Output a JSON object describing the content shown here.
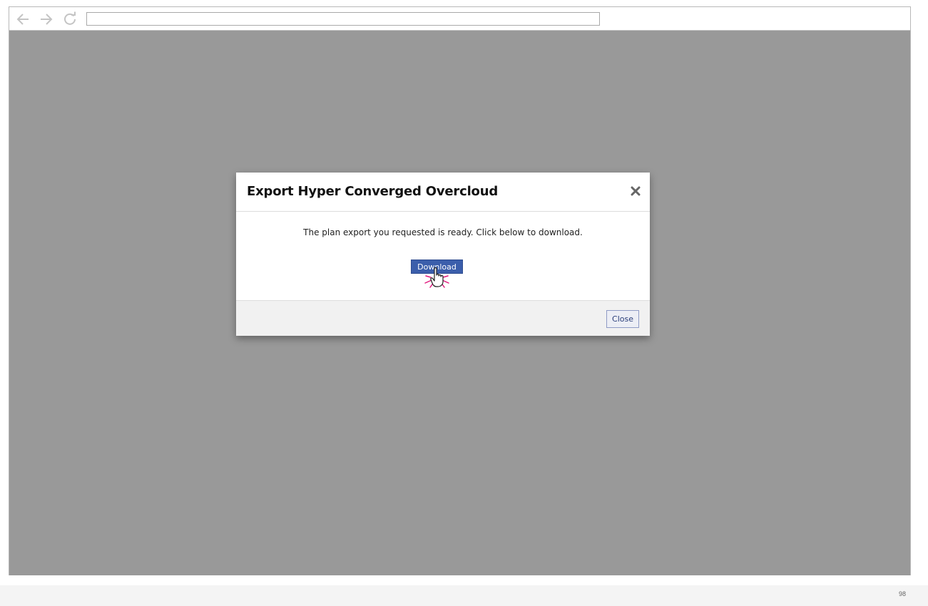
{
  "browser": {
    "url": ""
  },
  "modal": {
    "title": "Export Hyper Converged Overcloud",
    "message": "The plan export you requested is ready. Click below to download.",
    "download_label": "Download",
    "close_label": "Close"
  },
  "footer": {
    "page_number": "98"
  },
  "colors": {
    "overlay": "#999999",
    "primary_button": "#3b5eab",
    "click_indicator": "#e0197d"
  },
  "icons": {
    "back": "arrow-left-icon",
    "forward": "arrow-right-icon",
    "reload": "reload-icon",
    "close": "close-x-icon",
    "cursor": "hand-pointer-icon"
  }
}
